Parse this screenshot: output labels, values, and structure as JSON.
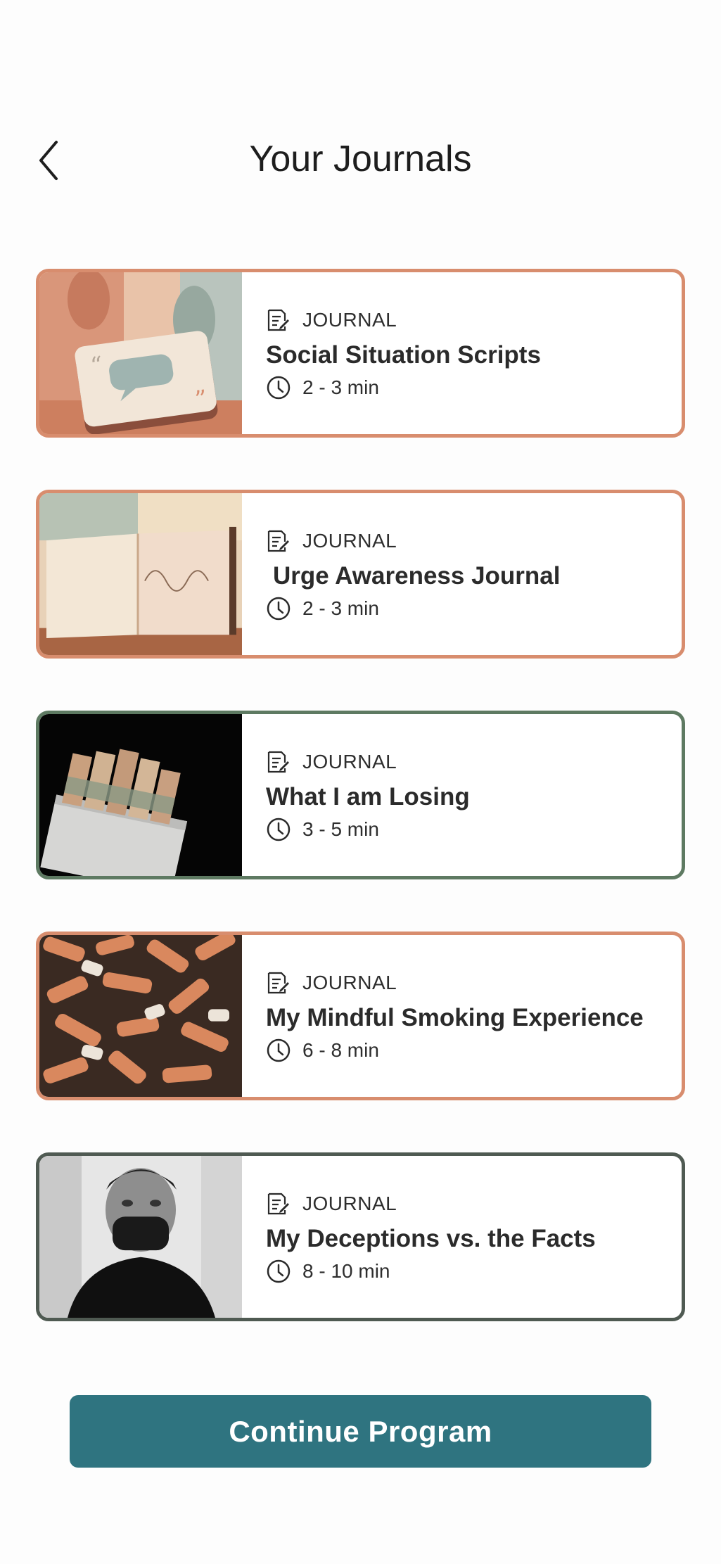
{
  "header": {
    "title": "Your Journals",
    "back_icon": "chevron-left-icon"
  },
  "journals": [
    {
      "tag": "JOURNAL",
      "title": "Social Situation Scripts",
      "duration": "2 - 3 min",
      "border_color": "#d88d6e",
      "image": "speech-cards-illustration"
    },
    {
      "tag": "JOURNAL",
      "title": "Urge Awareness Journal",
      "duration": "2 - 3 min",
      "border_color": "#d88d6e",
      "image": "open-notebook-illustration"
    },
    {
      "tag": "JOURNAL",
      "title": "What I am Losing",
      "duration": "3 - 5 min",
      "border_color": "#5e7a62",
      "image": "money-cigarette-pack-photo"
    },
    {
      "tag": "JOURNAL",
      "title": "My Mindful Smoking Experience",
      "duration": "6 - 8 min",
      "border_color": "#d88d6e",
      "image": "cigarette-butts-photo"
    },
    {
      "tag": "JOURNAL",
      "title": "My Deceptions vs. the Facts",
      "duration": "8 - 10 min",
      "border_color": "#4f5a52",
      "image": "masked-man-photo"
    }
  ],
  "icons": {
    "tag_icon": "journal-edit-icon",
    "duration_icon": "clock-icon"
  },
  "cta": {
    "label": "Continue Program",
    "color": "#2f7480"
  }
}
